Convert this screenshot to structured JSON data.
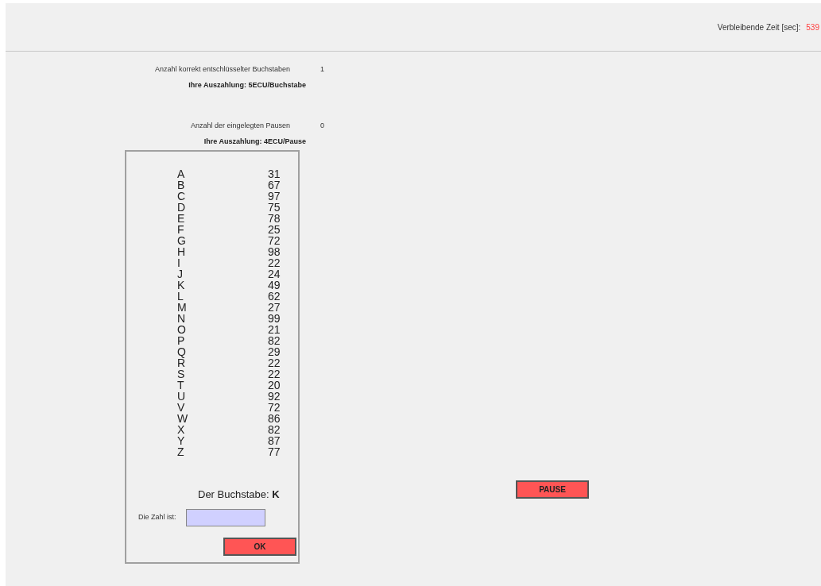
{
  "timer": {
    "label": "Verbleibende Zeit [sec]:",
    "value": "539"
  },
  "stats": [
    {
      "label": "Anzahl korrekt entschlüsselter Buchstaben",
      "value": "1",
      "payout": "Ihre Auszahlung: 5ECU/Buchstabe"
    },
    {
      "label": "Anzahl der eingelegten Pausen",
      "value": "0",
      "payout": "Ihre Auszahlung: 4ECU/Pause"
    }
  ],
  "code_table": [
    {
      "letter": "A",
      "number": "31"
    },
    {
      "letter": "B",
      "number": "67"
    },
    {
      "letter": "C",
      "number": "97"
    },
    {
      "letter": "D",
      "number": "75"
    },
    {
      "letter": "E",
      "number": "78"
    },
    {
      "letter": "F",
      "number": "25"
    },
    {
      "letter": "G",
      "number": "72"
    },
    {
      "letter": "H",
      "number": "98"
    },
    {
      "letter": "I",
      "number": "22"
    },
    {
      "letter": "J",
      "number": "24"
    },
    {
      "letter": "K",
      "number": "49"
    },
    {
      "letter": "L",
      "number": "62"
    },
    {
      "letter": "M",
      "number": "27"
    },
    {
      "letter": "N",
      "number": "99"
    },
    {
      "letter": "O",
      "number": "21"
    },
    {
      "letter": "P",
      "number": "82"
    },
    {
      "letter": "Q",
      "number": "29"
    },
    {
      "letter": "R",
      "number": "22"
    },
    {
      "letter": "S",
      "number": "22"
    },
    {
      "letter": "T",
      "number": "20"
    },
    {
      "letter": "U",
      "number": "92"
    },
    {
      "letter": "V",
      "number": "72"
    },
    {
      "letter": "W",
      "number": "86"
    },
    {
      "letter": "X",
      "number": "82"
    },
    {
      "letter": "Y",
      "number": "87"
    },
    {
      "letter": "Z",
      "number": "77"
    }
  ],
  "prompt": "Der Buchstabe: **K**",
  "answer_label": "Die Zahl ist:",
  "ok_button": "OK",
  "pause_button": "PAUSE"
}
